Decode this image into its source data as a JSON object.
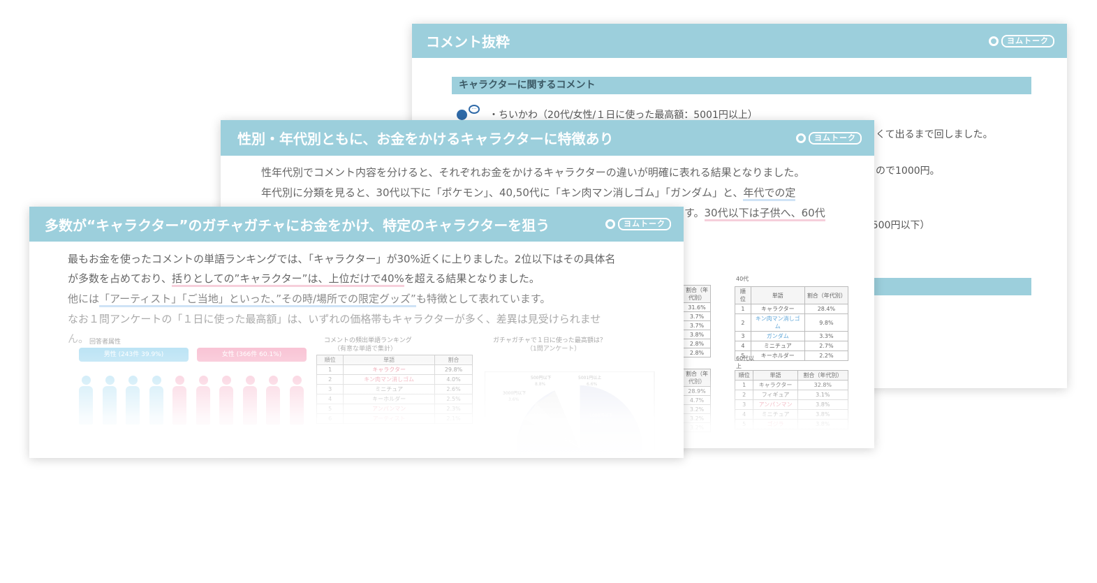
{
  "slide_back": {
    "title": "コメント抜粋",
    "logo": "ヨムトーク",
    "section_title": "キャラクターに関するコメント",
    "comments": [
      "・ちいかわ（20代/女性/１日に使った最高額：5001円以上）",
      "くて出るまで回しました。",
      "ので1000円。",
      "/500円以下）"
    ]
  },
  "slide_mid": {
    "title": "性別・年代別ともに、お金をかけるキャラクターに特徴あり",
    "logo": "ヨムトーク",
    "line1": "性年代別でコメント内容を分けると、それぞれお金をかけるキャラクターの違いが明確に表れる結果となりました。",
    "line2a": "年代別に分類を見ると、30代以下に「ポケモン」、40,50代に「キン肉マン消しゴム」「ガンダム」と、",
    "line2b": "年代での定",
    "line3a": "す。",
    "line3b": "30代以下は子供へ、60代",
    "label_40": "40代",
    "label_60": "60代以上",
    "table_headers": [
      "順位",
      "単語",
      "割合（年代別）"
    ],
    "left_col_header": "割合（年代別）",
    "left_values_top": [
      "31.6%",
      "3.7%",
      "3.7%",
      "3.8%",
      "2.8%",
      "2.8%"
    ],
    "left_values_bottom": [
      "28.9%",
      "4.7%",
      "3.2%",
      "3.2%",
      "3.2%"
    ],
    "table_40": [
      {
        "rank": "1",
        "word": "キャラクター",
        "pct": "28.4%"
      },
      {
        "rank": "2",
        "word": "キン肉マン消しゴム",
        "pct": "9.8%"
      },
      {
        "rank": "3",
        "word": "ガンダム",
        "pct": "3.3%"
      },
      {
        "rank": "4",
        "word": "ミニチュア",
        "pct": "2.7%"
      },
      {
        "rank": "5",
        "word": "キーホルダー",
        "pct": "2.2%"
      }
    ],
    "table_60": [
      {
        "rank": "1",
        "word": "キャラクター",
        "pct": "32.8%"
      },
      {
        "rank": "2",
        "word": "フィギュア",
        "pct": "3.1%"
      },
      {
        "rank": "3",
        "word": "アンパンマン",
        "pct": "3.8%"
      },
      {
        "rank": "4",
        "word": "ミニチュア",
        "pct": "3.8%"
      },
      {
        "rank": "5",
        "word": "ゴジラ",
        "pct": "3.8%"
      }
    ]
  },
  "slide_front": {
    "title": "多数が“キャラクター”のガチャガチャにお金をかけ、特定のキャラクターを狙う",
    "logo": "ヨムトーク",
    "p1": "最もお金を使ったコメントの単語ランキングでは、「キャラクター」が30%近くに上りました。2位以下はその具体名",
    "p2a": "が多数を占めており、",
    "p2b": "括りとしての”キャラクター”は、上位だけで40%",
    "p2c": "を超える結果となりました。",
    "p3a": "他には",
    "p3b": "「アーティスト」「ご当地」といった、”その時/場所での限定グッズ”",
    "p3c": "も特徴として表れています。",
    "p4": "なお１問アンケートの「１日に使った最高額」は、いずれの価格帯もキャラクターが多く、差異は見受けられませ",
    "p5": "ん。",
    "attr_label": "回答者属性",
    "male_label": "男性 (243件 39.9%)",
    "female_label": "女性 (366件 60.1%)",
    "ranking_title": "コメントの頻出単語ランキング",
    "ranking_sub": "（有意な単語で集計）",
    "pie_title": "ガチャガチャで１日に使った最高額は？",
    "pie_sub": "（1問アンケート）",
    "ranking_headers": [
      "順位",
      "単語",
      "割合"
    ],
    "ranking_rows": [
      {
        "rank": "1",
        "word": "キャラクター",
        "pct": "29.8%"
      },
      {
        "rank": "2",
        "word": "キン肉マン消しゴム",
        "pct": "4.0%"
      },
      {
        "rank": "3",
        "word": "ミニチュア",
        "pct": "2.6%"
      },
      {
        "rank": "4",
        "word": "キーホルダー",
        "pct": "2.5%"
      },
      {
        "rank": "5",
        "word": "アンパンマン",
        "pct": "2.3%"
      },
      {
        "rank": "6",
        "word": "アーティスト",
        "pct": "2.1%"
      }
    ],
    "pie_labels": [
      "500円以下",
      "5001円以上",
      "3000円以下",
      "1000円以下"
    ],
    "pie_pcts": [
      "8.8%",
      "6.6%",
      "3.6%",
      "38%"
    ],
    "male_color": "#a9dcf2",
    "female_color": "#f7b3c9"
  }
}
